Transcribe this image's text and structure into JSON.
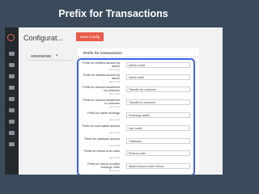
{
  "page_heading": "Prefix for Transactions",
  "app": {
    "title": "Configurat...",
    "save_label": "Save Config"
  },
  "scope": {
    "label": "ADVANCED"
  },
  "section": {
    "title": "Prefix for transactions"
  },
  "fields": [
    {
      "label": "Prefix for credited amount by admin",
      "scope": "[store view]",
      "value": "Admin credit"
    },
    {
      "label": "Prefix for debited amount by admin",
      "scope": "[store view]",
      "value": "Admin debit"
    },
    {
      "label": "Prefix for amount transferred by customer",
      "scope": "[store view]",
      "value": "Transfer by customer"
    },
    {
      "label": "Prefix for amount transferred to customer",
      "scope": "[store view]",
      "value": "Transfer to customer"
    },
    {
      "label": "Prefix for wallet recharge",
      "scope": "[store view]",
      "value": "Recharge wallet"
    },
    {
      "label": "Prefix for used wallet amount",
      "scope": "[store view]",
      "value": "Use wallet"
    },
    {
      "label": "Prefix for cashback amount",
      "scope": "[store view]",
      "value": "Cashback"
    },
    {
      "label": "Prefix for refund of an order",
      "scope": "[store view]",
      "value": "Refund order"
    },
    {
      "label": "Prefix for refund of wallet recharge order",
      "scope": "[store view]",
      "value": "Wallet amount order refund"
    }
  ],
  "colors": {
    "background": "#3b4b5c",
    "accent": "#e85d4a",
    "highlight": "#3b63e8"
  }
}
